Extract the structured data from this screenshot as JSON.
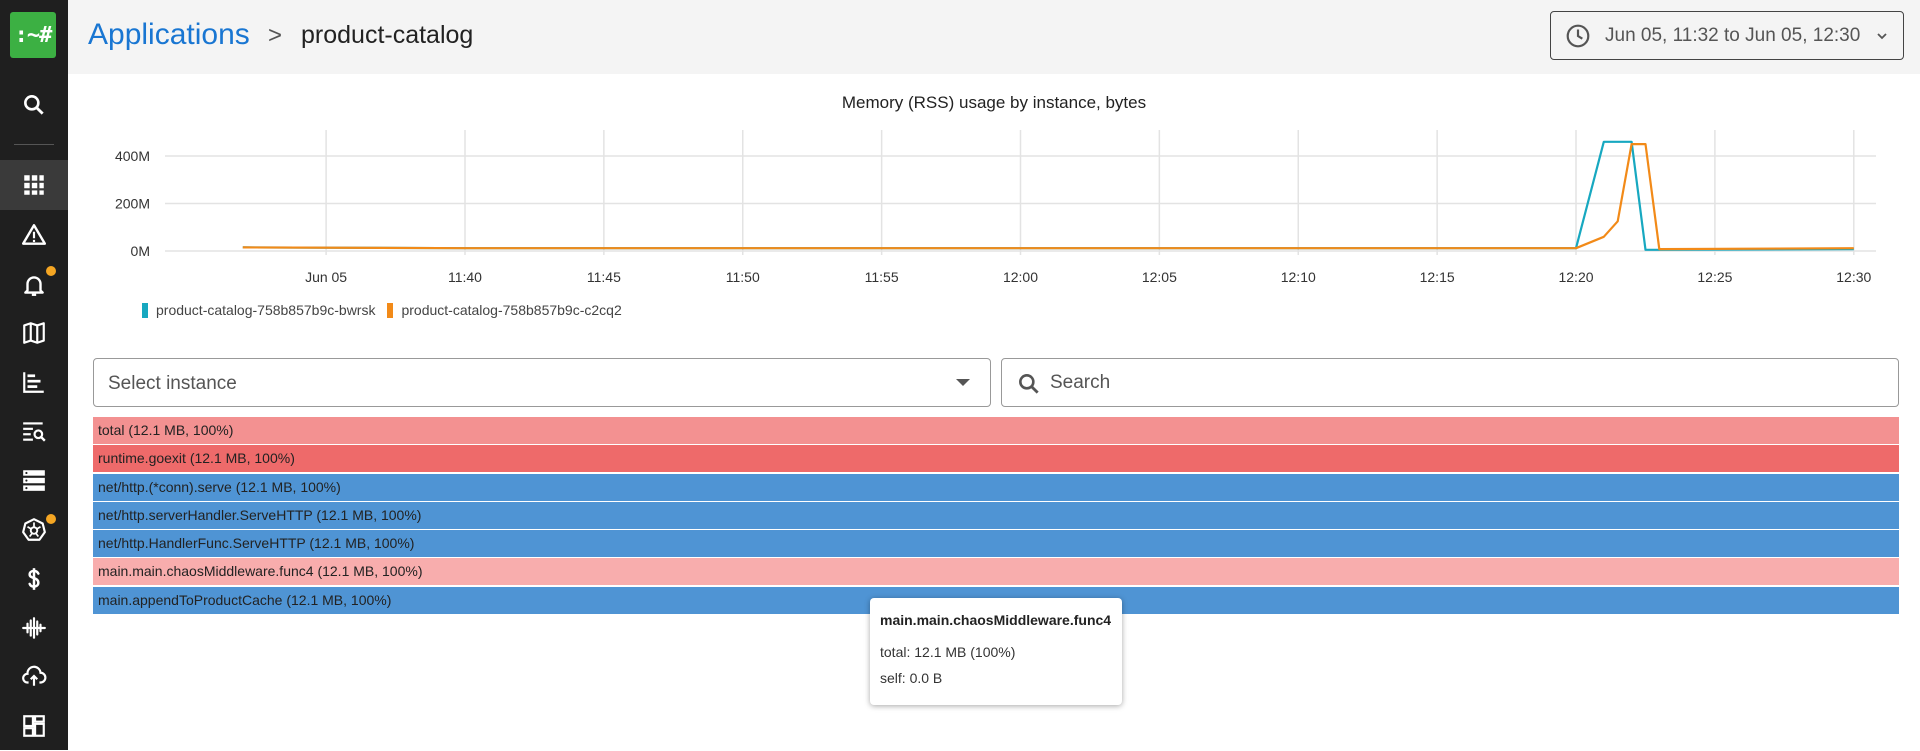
{
  "app": {
    "logo": ":~#"
  },
  "header": {
    "breadcrumb_root": "Applications",
    "breadcrumb_separator": ">",
    "breadcrumb_current": "product-catalog",
    "time_range": "Jun 05, 11:32 to Jun 05, 12:30"
  },
  "sidebar": {
    "items": [
      {
        "icon": "search-icon"
      },
      {
        "icon": "apps-grid-icon",
        "active": true
      },
      {
        "icon": "warning-icon"
      },
      {
        "icon": "bell-icon",
        "badge": true
      },
      {
        "icon": "map-icon"
      },
      {
        "icon": "bar-chart-icon"
      },
      {
        "icon": "log-search-icon"
      },
      {
        "icon": "server-icon"
      },
      {
        "icon": "kubernetes-icon",
        "badge": true
      },
      {
        "icon": "dollar-icon"
      },
      {
        "icon": "waveform-icon"
      },
      {
        "icon": "cloud-upload-icon"
      },
      {
        "icon": "dashboard-icon"
      }
    ],
    "badge_color": "#f5a623"
  },
  "chart_data": {
    "type": "line",
    "title": "Memory (RSS) usage by instance, bytes",
    "x_tick_labels": [
      "Jun 05",
      "11:40",
      "11:45",
      "11:50",
      "11:55",
      "12:00",
      "12:05",
      "12:10",
      "12:15",
      "12:20",
      "12:25",
      "12:30"
    ],
    "y_tick_labels": [
      "0M",
      "200M",
      "400M"
    ],
    "ylim": [
      0,
      500
    ],
    "y_unit": "M",
    "grid": true,
    "legend_position": "bottom-left",
    "series": [
      {
        "name": "product-catalog-758b857b9c-bwrsk",
        "color": "#17a8c0",
        "points": [
          [
            "11:32",
            15
          ],
          [
            "11:40",
            12
          ],
          [
            "11:50",
            12
          ],
          [
            "12:00",
            12
          ],
          [
            "12:10",
            12
          ],
          [
            "12:20",
            12
          ],
          [
            "12:21",
            460
          ],
          [
            "12:22",
            460
          ],
          [
            "12:22.5",
            5
          ],
          [
            "12:23",
            5
          ],
          [
            "12:30",
            8
          ]
        ]
      },
      {
        "name": "product-catalog-758b857b9c-c2cq2",
        "color": "#f28a18",
        "points": [
          [
            "11:32",
            15
          ],
          [
            "11:40",
            12
          ],
          [
            "11:50",
            12
          ],
          [
            "12:00",
            12
          ],
          [
            "12:10",
            12
          ],
          [
            "12:20",
            12
          ],
          [
            "12:21",
            60
          ],
          [
            "12:21.5",
            125
          ],
          [
            "12:22",
            450
          ],
          [
            "12:22.5",
            450
          ],
          [
            "12:23",
            8
          ],
          [
            "12:30",
            12
          ]
        ]
      }
    ]
  },
  "controls": {
    "select_placeholder": "Select instance",
    "search_placeholder": "Search"
  },
  "flamegraph": {
    "frames": [
      {
        "label": "total (12.1 MB, 100%)",
        "color": "#f39191"
      },
      {
        "label": "runtime.goexit (12.1 MB, 100%)",
        "color": "#ee6a6a"
      },
      {
        "label": "net/http.(*conn).serve (12.1 MB, 100%)",
        "color": "#4f94d4"
      },
      {
        "label": "net/http.serverHandler.ServeHTTP (12.1 MB, 100%)",
        "color": "#4f94d4"
      },
      {
        "label": "net/http.HandlerFunc.ServeHTTP (12.1 MB, 100%)",
        "color": "#4f94d4"
      },
      {
        "label": "main.main.chaosMiddleware.func4 (12.1 MB, 100%)",
        "color": "#f8adad"
      },
      {
        "label": "main.appendToProductCache (12.1 MB, 100%)",
        "color": "#4f94d4"
      }
    ]
  },
  "tooltip": {
    "title": "main.main.chaosMiddleware.func4",
    "total": "total: 12.1 MB (100%)",
    "self": "self: 0.0 B"
  }
}
